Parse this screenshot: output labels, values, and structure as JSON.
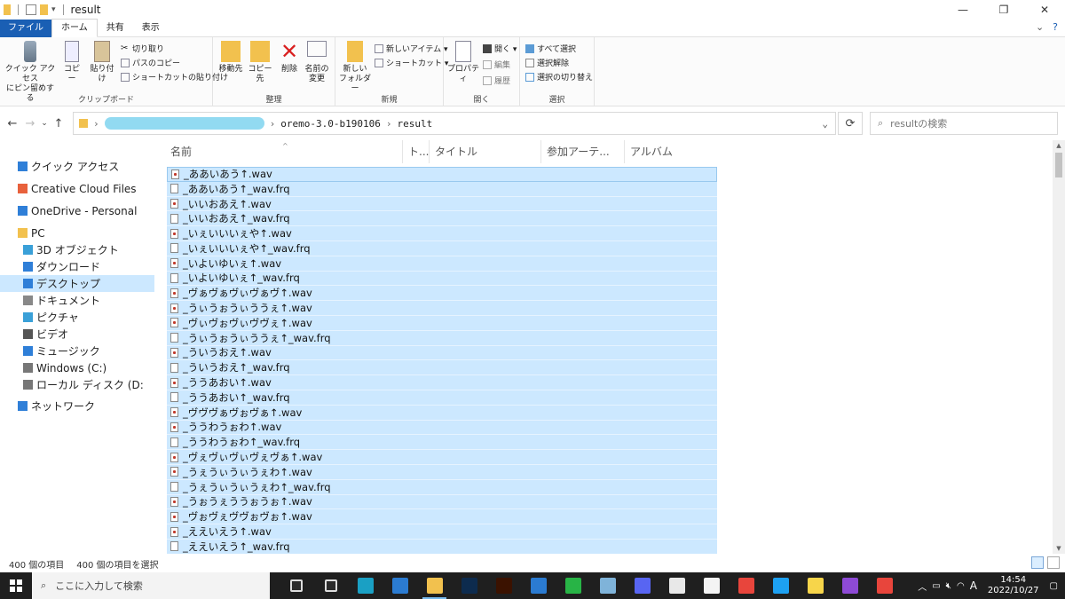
{
  "window": {
    "title": "result"
  },
  "tabs": {
    "file": "ファイル",
    "home": "ホーム",
    "share": "共有",
    "view": "表示"
  },
  "ribbon": {
    "clipboard": {
      "label": "クリップボード",
      "pin": "クイック アクセス\nにピン留めする",
      "copy": "コピー",
      "paste": "貼り付け",
      "cut": "切り取り",
      "copy_path": "パスのコピー",
      "paste_shortcut": "ショートカットの貼り付け"
    },
    "organize": {
      "label": "整理",
      "move_to": "移動先",
      "copy_to": "コピー先",
      "delete": "削除",
      "rename": "名前の\n変更"
    },
    "new": {
      "label": "新規",
      "new_folder": "新しい\nフォルダー",
      "new_item": "新しいアイテム ▾",
      "shortcut": "ショートカット ▾"
    },
    "open": {
      "label": "開く",
      "properties": "プロパティ",
      "open": "開く ▾",
      "edit": "編集",
      "history": "履歴"
    },
    "select": {
      "label": "選択",
      "select_all": "すべて選択",
      "select_none": "選択解除",
      "invert": "選択の切り替え"
    }
  },
  "address": {
    "path_tail": "oremo-3.0-b190106",
    "current": "result",
    "search_placeholder": "resultの検索"
  },
  "nav": [
    {
      "label": "クイック アクセス",
      "icon": "star-icon",
      "indent": 0
    },
    {
      "label": "Creative Cloud Files",
      "icon": "creative-cloud-icon",
      "indent": 0
    },
    {
      "label": "OneDrive - Personal",
      "icon": "onedrive-icon",
      "indent": 0
    },
    {
      "label": "PC",
      "icon": "pc-icon",
      "indent": 0
    },
    {
      "label": "3D オブジェクト",
      "icon": "3d-objects-icon",
      "indent": 1
    },
    {
      "label": "ダウンロード",
      "icon": "download-icon",
      "indent": 1
    },
    {
      "label": "デスクトップ",
      "icon": "desktop-icon",
      "indent": 1,
      "selected": true
    },
    {
      "label": "ドキュメント",
      "icon": "documents-icon",
      "indent": 1
    },
    {
      "label": "ピクチャ",
      "icon": "pictures-icon",
      "indent": 1
    },
    {
      "label": "ビデオ",
      "icon": "video-icon",
      "indent": 1
    },
    {
      "label": "ミュージック",
      "icon": "music-icon",
      "indent": 1
    },
    {
      "label": "Windows (C:)",
      "icon": "drive-icon",
      "indent": 1
    },
    {
      "label": "ローカル ディスク (D:",
      "icon": "local-disk-icon",
      "indent": 1
    },
    {
      "label": "ネットワーク",
      "icon": "network-icon",
      "indent": 0
    }
  ],
  "columns": {
    "name": "名前",
    "track": "ト...",
    "title": "タイトル",
    "artist": "参加アーテ...",
    "album": "アルバム"
  },
  "files": [
    {
      "name": "_ああいあう↑.wav",
      "type": "wav"
    },
    {
      "name": "_ああいあう↑_wav.frq",
      "type": "frq"
    },
    {
      "name": "_いいおあえ↑.wav",
      "type": "wav"
    },
    {
      "name": "_いいおあえ↑_wav.frq",
      "type": "frq"
    },
    {
      "name": "_いぇいいいぇや↑.wav",
      "type": "wav"
    },
    {
      "name": "_いぇいいいぇや↑_wav.frq",
      "type": "frq"
    },
    {
      "name": "_いよいゆいぇ↑.wav",
      "type": "wav"
    },
    {
      "name": "_いよいゆいぇ↑_wav.frq",
      "type": "frq"
    },
    {
      "name": "_ヴぁヴぁヴぃヴぁヴ↑.wav",
      "type": "wav"
    },
    {
      "name": "_うぃうぉうぃううぇ↑.wav",
      "type": "wav"
    },
    {
      "name": "_ヴぃヴぉヴぃヴヴぇ↑.wav",
      "type": "wav"
    },
    {
      "name": "_うぃうぉうぃううぇ↑_wav.frq",
      "type": "frq"
    },
    {
      "name": "_ういうおえ↑.wav",
      "type": "wav"
    },
    {
      "name": "_ういうおえ↑_wav.frq",
      "type": "frq"
    },
    {
      "name": "_ううあおい↑.wav",
      "type": "wav"
    },
    {
      "name": "_ううあおい↑_wav.frq",
      "type": "frq"
    },
    {
      "name": "_ヴヴヴぁヴぉヴぁ↑.wav",
      "type": "wav"
    },
    {
      "name": "_ううわうぉわ↑.wav",
      "type": "wav"
    },
    {
      "name": "_ううわうぉわ↑_wav.frq",
      "type": "frq"
    },
    {
      "name": "_ヴぇヴぃヴぃヴぇヴぁ↑.wav",
      "type": "wav"
    },
    {
      "name": "_うぇうぃうぃうぇわ↑.wav",
      "type": "wav"
    },
    {
      "name": "_うぇうぃうぃうぇわ↑_wav.frq",
      "type": "frq"
    },
    {
      "name": "_うぉうぇううぉうぉ↑.wav",
      "type": "wav"
    },
    {
      "name": "_ヴぉヴぇヴヴぉヴぉ↑.wav",
      "type": "wav"
    },
    {
      "name": "_ええいえう↑.wav",
      "type": "wav"
    },
    {
      "name": "_ええいえう↑_wav.frq",
      "type": "frq"
    }
  ],
  "status": {
    "count": "400 個の項目",
    "selected": "400 個の項目を選択"
  },
  "taskbar": {
    "search_placeholder": "ここに入力して検索",
    "time": "14:54",
    "date": "2022/10/27",
    "ime": "A",
    "apps": [
      {
        "name": "task-view-icon",
        "color": "#2b2b2b"
      },
      {
        "name": "widgets-icon",
        "color": "#2b2b2b"
      },
      {
        "name": "edge-icon",
        "color": "#1aa0c4"
      },
      {
        "name": "store-icon",
        "color": "#2b7bd1"
      },
      {
        "name": "explorer-icon",
        "color": "#f2c14e",
        "active": true
      },
      {
        "name": "photoshop-icon",
        "color": "#0d2b4e"
      },
      {
        "name": "illustrator-icon",
        "color": "#3b1200"
      },
      {
        "name": "mail-icon",
        "color": "#2b7bd1"
      },
      {
        "name": "line-icon",
        "color": "#28b446"
      },
      {
        "name": "notepad-icon",
        "color": "#7fb3d9"
      },
      {
        "name": "discord-icon",
        "color": "#5865f2"
      },
      {
        "name": "paint-icon",
        "color": "#e8e8e8"
      },
      {
        "name": "clip-studio-icon",
        "color": "#f4f4f4"
      },
      {
        "name": "chrome-icon",
        "color": "#e8453c"
      },
      {
        "name": "twitter-icon",
        "color": "#1da1f2"
      },
      {
        "name": "sticky-icon",
        "color": "#f7d54a"
      },
      {
        "name": "visual-studio-icon",
        "color": "#8e4ad6"
      },
      {
        "name": "chrome-alt-icon",
        "color": "#e8453c"
      }
    ]
  }
}
